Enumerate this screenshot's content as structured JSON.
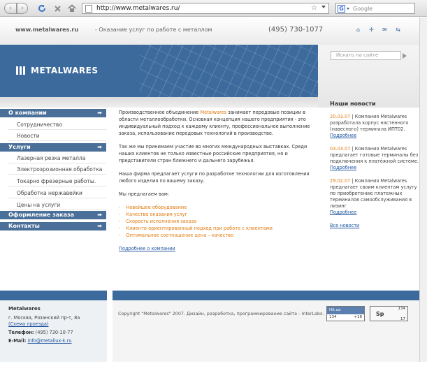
{
  "browser": {
    "url": "http://www.metalwares.ru/",
    "search_placeholder": "Google",
    "search_engine_letter": "G"
  },
  "header": {
    "site_url": "www.metalwares.ru",
    "tagline": "- Оказание услуг по работе с металлом",
    "phone": "(495) 730-1077"
  },
  "banner": {
    "logo_text": "METALWARES"
  },
  "site_search": {
    "placeholder": "Искать на сайте"
  },
  "sidebar": {
    "sections": [
      {
        "label": "О компании",
        "items": [
          "Сотрудничество",
          "Новости"
        ]
      },
      {
        "label": "Услуги",
        "items": [
          "Лазерная резка металла",
          "Электроэрозионная обработка",
          "Токарно фрезерные работы.",
          "Обработка нержавейки",
          "Цены на услуги"
        ]
      },
      {
        "label": "Оформление заказа",
        "items": []
      },
      {
        "label": "Контакты",
        "items": []
      }
    ]
  },
  "content": {
    "p1_before": "Производственное объединение ",
    "p1_brand": "Metalwares",
    "p1_after": " занимает передовые позиции в области металлообработки. Основная концепция нашего предприятия - это индивидуальный подход к каждому клиенту, профессиональное выполнение заказа, использование передовых технологий в производстве.",
    "p2": "Так же мы принимаем участие во многих международных выставках. Среди наших клиентов не только известные российские предприятия, но и представители стран ближнего и дальнего зарубежья.",
    "p3": "Наша фирма предлагает услуги по разработке технологии для изготовления любого изделия по вашему заказу.",
    "offer_intro": "Мы предлагаем вам:",
    "offers": [
      "Новейшее оборудование",
      "Качество оказания услуг",
      "Скорость исполнения заказа",
      "Клиенто-ориентированный подход при работе с клиентами",
      "Оптимальное соотношение цена – качество"
    ],
    "more_link": "Подробнее о компании"
  },
  "news": {
    "title": "Наши новости",
    "items": [
      {
        "date": "20.03.07",
        "text": "Компания Metalwares разработала корпус настенного (навесного) терминала ИПТ02.",
        "link": "Подробнее"
      },
      {
        "date": "03.03.07",
        "text": "Компания Metalwares предлагает готовые терминалы без подключения к платёжной системе.",
        "link": "Подробнее"
      },
      {
        "date": "29.02.07",
        "text": "Компания Metalwares предлагает своим клиентам услугу по приобретению платежных терминалов самообслуживания в лизинг",
        "link": "Подробнее"
      }
    ],
    "all_link": "Все новости"
  },
  "footer": {
    "company": "Metalwares",
    "address": "г. Москва, Рязанский пр-т, 8а",
    "map_link": "(Схема проезда)",
    "phone_label": "Телефон:",
    "phone": "(495) 730-10-77",
    "email_label": "E-Mail:",
    "email": "info@metallux-k.ru",
    "copyright": "Copyright \"Metalwares\" 2007. Дизайн, разработка, программирование сайта - InterLabs.",
    "counter1_top": "Hit.ua",
    "counter1_bottom_left": "134",
    "counter1_bottom_right": "+18",
    "counter2_top": "134",
    "counter2_mid": "Sp",
    "counter2_bottom": "17"
  },
  "colors": {
    "brand_blue": "#3c6a9c",
    "accent_orange": "#e07a10",
    "link_blue": "#1f55a0"
  }
}
